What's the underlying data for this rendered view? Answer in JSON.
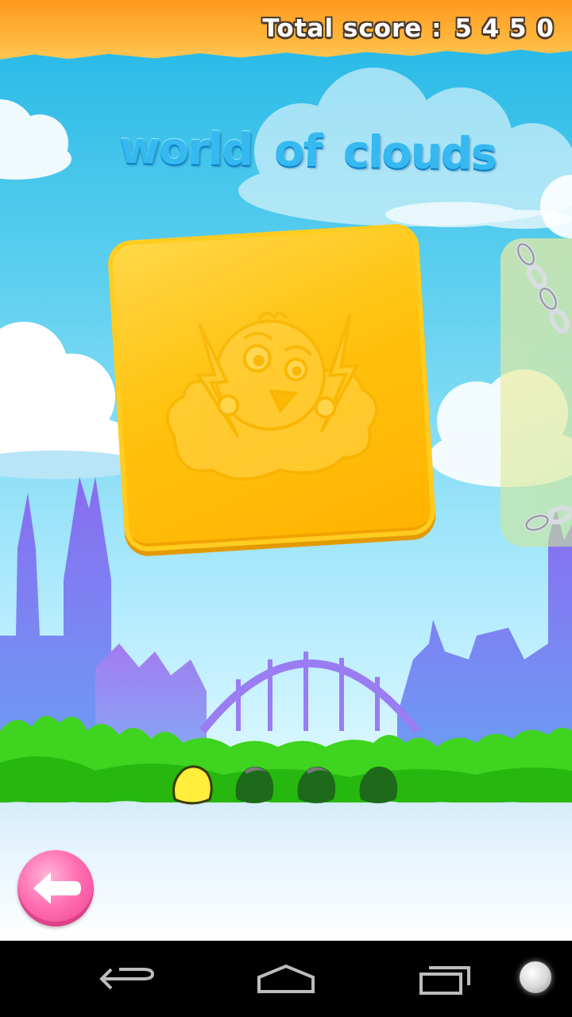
{
  "header": {
    "score_label": "Total score :",
    "score_value": "5 4 5 0"
  },
  "world": {
    "title_word1": "world",
    "title_word2": "of",
    "title_word3": "clouds"
  },
  "progress": {
    "levels_total": 4,
    "levels_done": 1
  },
  "icons": {
    "back": "back-arrow-icon",
    "nav_back": "nav-back-icon",
    "nav_home": "nav-home-icon",
    "nav_recents": "nav-recents-icon",
    "lock": "chain-icon"
  },
  "colors": {
    "header": "#ffa726",
    "card": "#ffc20e",
    "title": "#36b9f0",
    "back_button": "#ff6fb2",
    "grass": "#3fd41f"
  }
}
